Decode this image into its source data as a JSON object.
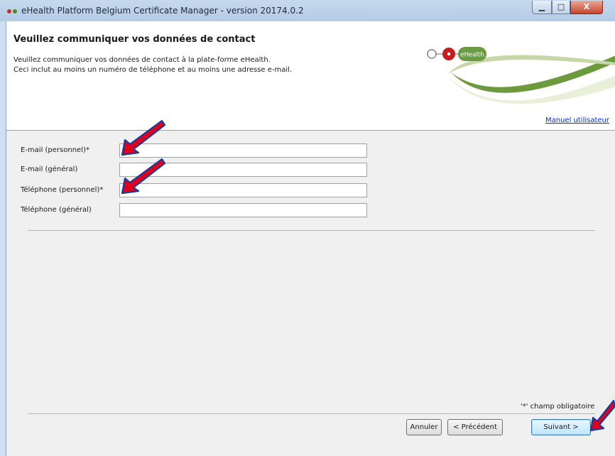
{
  "window": {
    "title": "eHealth Platform Belgium Certificate Manager - version 20174.0.2",
    "minimize_glyph": "▁",
    "maximize_glyph": "□",
    "close_glyph": "X"
  },
  "header": {
    "title": "Veuillez communiquer vos données de contact",
    "description_line1": "Veuillez communiquer vos données de contact à la plate-forme eHealth.",
    "description_line2": "Ceci inclut au moins un numéro de téléphone et au moins une adresse e-mail.",
    "logo_text": "eHealth",
    "manual_link": "Manuel utilisateur"
  },
  "form": {
    "email_personal_label": "E-mail (personnel)*",
    "email_personal_value": "",
    "email_general_label": "E-mail (général)",
    "email_general_value": "",
    "phone_personal_label": "Téléphone (personnel)*",
    "phone_personal_value": "",
    "phone_general_label": "Téléphone (général)",
    "phone_general_value": ""
  },
  "footer": {
    "required_note": "'*' champ obligatoire",
    "cancel_label": "Annuler",
    "previous_label": "< Précédent",
    "next_label": "Suivant >"
  },
  "colors": {
    "accent_red": "#cc1f1f",
    "logo_green": "#5a8a3c",
    "annotation_arrow": "#e3001b",
    "annotation_outline": "#1a3a9c"
  }
}
